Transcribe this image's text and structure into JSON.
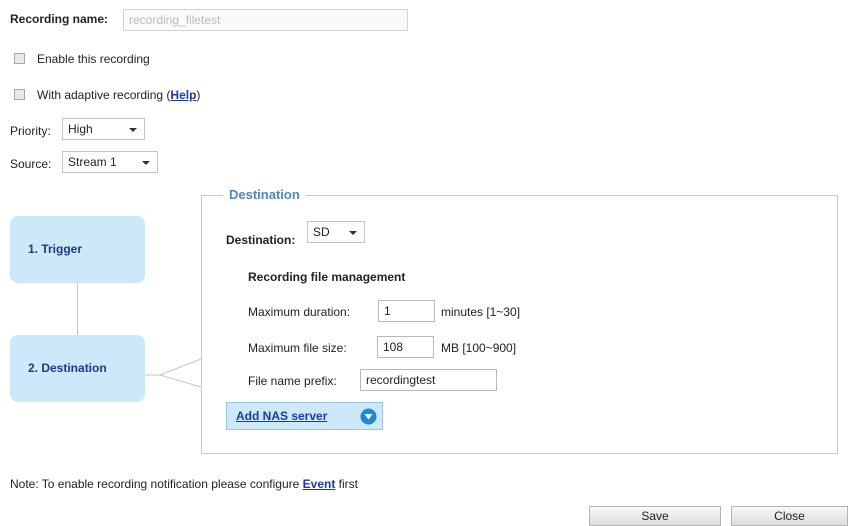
{
  "recording_name": {
    "label": "Recording name:",
    "value": "recording_filetest"
  },
  "enable_recording": {
    "label": "Enable this recording",
    "checked": false
  },
  "adaptive_recording": {
    "label": "With adaptive recording (",
    "help_link": "Help",
    "suffix": ")",
    "checked": false
  },
  "priority": {
    "label": "Priority:",
    "selected": "High"
  },
  "source": {
    "label": "Source:",
    "selected": "Stream 1"
  },
  "steps": {
    "trigger": "1. Trigger",
    "destination": "2. Destination"
  },
  "destination_panel": {
    "legend": "Destination",
    "destination_label": "Destination:",
    "destination_selected": "SD",
    "file_management_title": "Recording file management",
    "max_duration_label": "Maximum duration:",
    "max_duration_value": "1",
    "max_duration_unit": "minutes [1~30]",
    "max_file_size_label": "Maximum file size:",
    "max_file_size_value": "108",
    "max_file_size_unit": "MB [100~900]",
    "file_prefix_label": "File name prefix:",
    "file_prefix_value": "recordingtest",
    "add_nas_label": "Add NAS server"
  },
  "note": {
    "text": "Note: To enable recording notification please configure ",
    "link": "Event",
    "suffix": " first"
  },
  "buttons": {
    "save": "Save",
    "close": "Close"
  },
  "colors": {
    "step_bg": "#cde8f8",
    "step_text": "#1c3a8a",
    "legend": "#4f86c8",
    "link": "#1a3aa8",
    "nas_icon": "#1b8ad0"
  }
}
